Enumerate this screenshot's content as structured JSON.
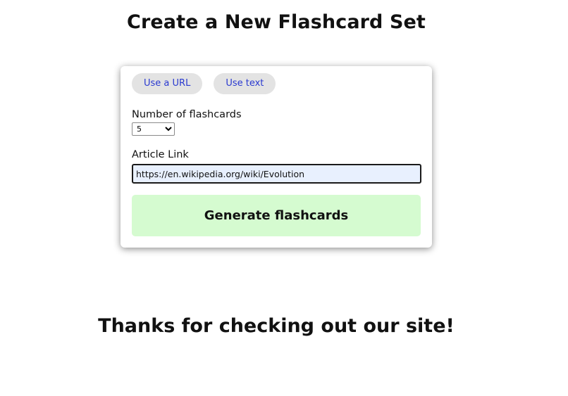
{
  "page": {
    "title": "Create a New Flashcard Set",
    "footer_message": "Thanks for checking out our site!"
  },
  "form": {
    "mode_buttons": [
      {
        "label": "Use a URL"
      },
      {
        "label": "Use text"
      }
    ],
    "count_label": "Number of flashcards",
    "count_value": "5",
    "count_options": [
      "5"
    ],
    "link_label": "Article Link",
    "link_value": "https://en.wikipedia.org/wiki/Evolution",
    "generate_label": "Generate flashcards"
  },
  "colors": {
    "mode_button_bg": "#e3e3e3",
    "mode_button_text": "#2a3ad0",
    "generate_button_bg": "#d5fbd0",
    "link_input_bg": "#e8f0fe"
  }
}
